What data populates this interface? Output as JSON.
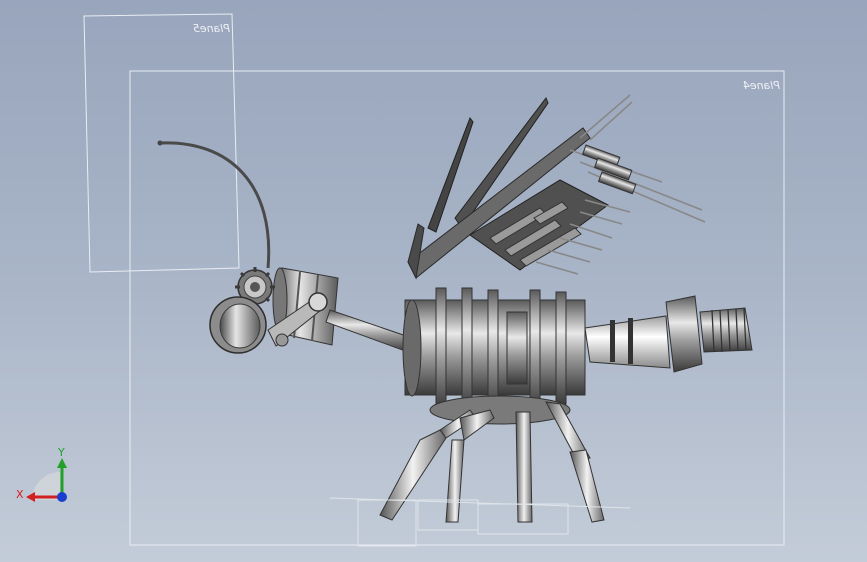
{
  "planes": {
    "plane5": {
      "label": "Plane5"
    },
    "plane4": {
      "label": "Plane4"
    }
  },
  "triad": {
    "x_label": "X",
    "y_label": "Y",
    "x_color": "#d22020",
    "y_color": "#22a02a",
    "z_color": "#1a3fd0"
  },
  "colors": {
    "background_top": "#98a5bc",
    "background_bottom": "#c3ccd8",
    "plane_outline": "#e6eaf0",
    "metal_dark": "#3f3f3f",
    "metal_mid": "#8f8f8f",
    "metal_light": "#dcdcdc"
  }
}
